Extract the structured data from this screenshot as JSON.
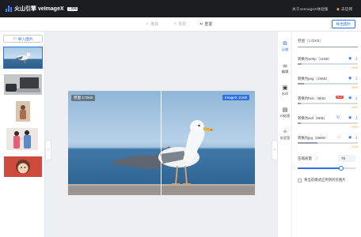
{
  "app": {
    "title": "火山引擎 veImageX",
    "badge": "工具箱",
    "about_link": "关于veImageX体验版",
    "website_link": "去官网"
  },
  "toolbar": {
    "undo_label": "撤销",
    "redo_label": "恢复",
    "reset_label": "重置",
    "export_label": "导出图片"
  },
  "sidebar": {
    "import_label": "导入图片",
    "thumbnails": [
      {
        "name": "thumb-seagull",
        "selected": true
      },
      {
        "name": "thumb-laptop",
        "selected": false
      },
      {
        "name": "thumb-portrait",
        "selected": false
      },
      {
        "name": "thumb-family",
        "selected": false
      },
      {
        "name": "thumb-cartoon",
        "selected": false
      }
    ]
  },
  "preview": {
    "original_label": "原图 172KB",
    "processed_label": "ImageX 11KB"
  },
  "tools": [
    {
      "label": "压缩",
      "icon": "compress-icon",
      "active": true
    },
    {
      "label": "编辑",
      "icon": "edit-icon",
      "active": false
    },
    {
      "label": "水印",
      "icon": "watermark-icon",
      "active": false
    },
    {
      "label": "AI处理",
      "icon": "ai-icon",
      "active": false
    },
    {
      "label": "实验室",
      "icon": "lab-icon",
      "active": false
    }
  ],
  "compress": {
    "original_size": "原图（172KB）",
    "formats": [
      {
        "label": "转换为webp（11KB）",
        "pct": "-94%",
        "ratio": 0.94,
        "hot": false,
        "spin": false
      },
      {
        "label": "转换为png（19KB）",
        "pct": "-89%",
        "ratio": 0.89,
        "hot": false,
        "spin": false
      },
      {
        "label": "转换为heic（8KB）",
        "pct": "-95%",
        "ratio": 0.95,
        "hot": true,
        "hot_label": "HOT",
        "spin": false
      },
      {
        "label": "转换为avif（8KB）",
        "pct": "-95%",
        "ratio": 0.95,
        "hot": false,
        "spin": true
      },
      {
        "label": "转换为jpg（56KB）",
        "pct": "-67%",
        "ratio": 0.67,
        "hot": false,
        "spin": false
      }
    ],
    "quality_label": "压缩质量",
    "quality_value": "75",
    "quality_ratio": 0.75,
    "apply_all_label": "将当前模式应用到所有图片"
  },
  "colors": {
    "accent": "#2f6fe4",
    "topbar": "#1b1d21",
    "saving": "#f5a623",
    "hot": "#e53935"
  }
}
